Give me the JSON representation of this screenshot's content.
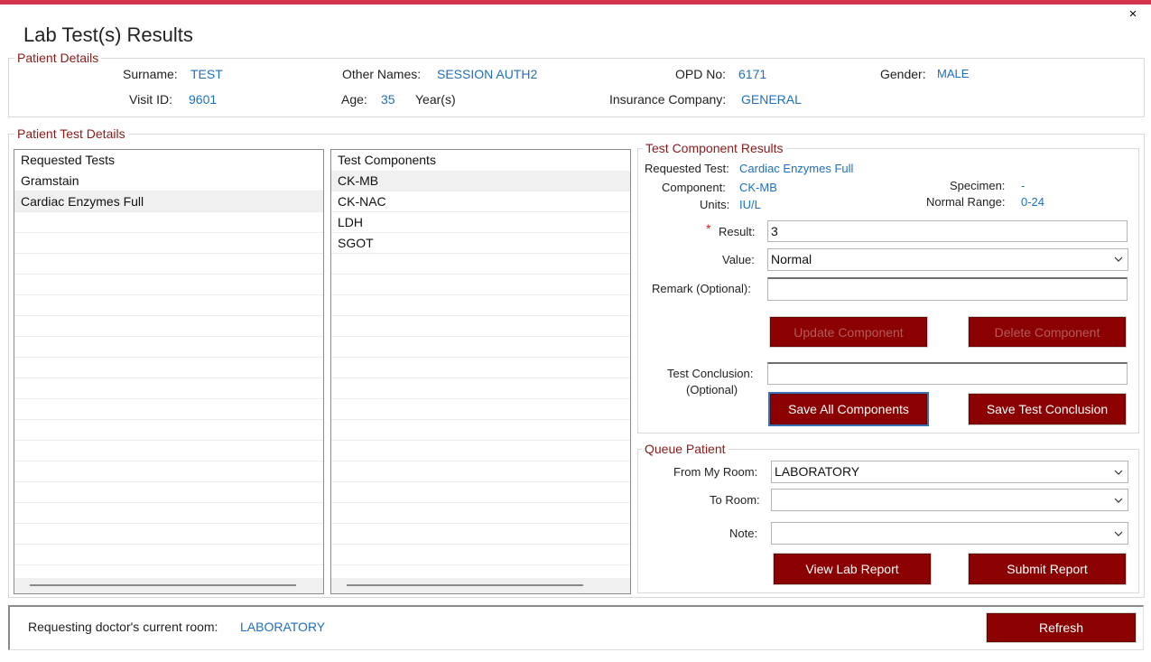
{
  "window": {
    "title": "Lab Test(s) Results",
    "close_label": "×"
  },
  "patient_details": {
    "legend": "Patient Details",
    "surname_label": "Surname:",
    "surname": "TEST",
    "other_names_label": "Other Names:",
    "other_names": "SESSION AUTH2",
    "opd_label": "OPD No:",
    "opd": "6171",
    "gender_label": "Gender:",
    "gender": "MALE",
    "visit_label": "Visit ID:",
    "visit": "9601",
    "age_label": "Age:",
    "age": "35",
    "age_unit": "Year(s)",
    "insurance_label": "Insurance Company:",
    "insurance": "GENERAL"
  },
  "test_details": {
    "legend": "Patient Test Details",
    "requested_tests": {
      "header": "Requested Tests",
      "items": [
        "Gramstain",
        "Cardiac Enzymes Full"
      ],
      "selected_index": 1
    },
    "test_components": {
      "header": "Test Components",
      "items": [
        "CK-MB",
        "CK-NAC",
        "LDH",
        "SGOT"
      ],
      "selected_index": 0
    }
  },
  "component_results": {
    "legend": "Test Component Results",
    "requested_test_label": "Requested Test:",
    "requested_test": "Cardiac Enzymes Full",
    "component_label": "Component:",
    "component": "CK-MB",
    "units_label": "Units:",
    "units": "IU/L",
    "specimen_label": "Specimen:",
    "specimen": "-",
    "normal_range_label": "Normal Range:",
    "normal_range": "0-24",
    "required_mark": "*",
    "result_label": "Result:",
    "result_value": "3",
    "value_label": "Value:",
    "value_selected": "Normal",
    "remark_label": "Remark (Optional):",
    "remark_value": "",
    "update_button": "Update Component",
    "delete_button": "Delete Component",
    "conclusion_label_1": "Test Conclusion:",
    "conclusion_label_2": "(Optional)",
    "conclusion_value": "",
    "save_all_button": "Save All Components",
    "save_conclusion_button": "Save Test Conclusion"
  },
  "queue": {
    "legend": "Queue Patient",
    "from_room_label": "From My Room:",
    "from_room": "LABORATORY",
    "to_room_label": "To Room:",
    "to_room": "",
    "note_label": "Note:",
    "note": "",
    "view_report_button": "View Lab Report",
    "submit_report_button": "Submit Report"
  },
  "footer": {
    "doctor_room_label": "Requesting doctor's current room:",
    "doctor_room": "LABORATORY",
    "refresh_button": "Refresh"
  },
  "colors": {
    "accent": "#8b0000",
    "link_blue": "#1f6fc0",
    "topbar": "#d6334f",
    "legend": "#8b1a1a"
  }
}
